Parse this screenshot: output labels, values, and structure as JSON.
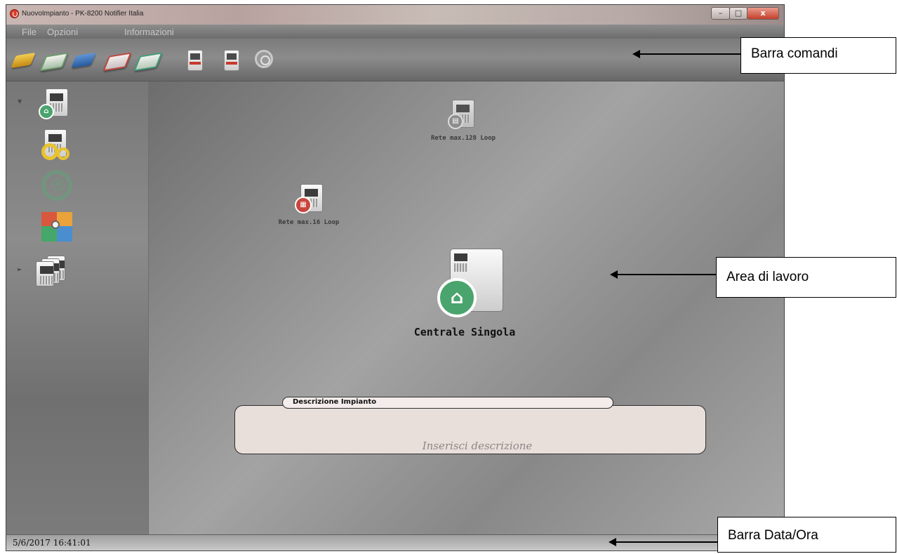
{
  "window": {
    "title": "NuovoImpianto - PK-8200 Notifier Italia",
    "controls": {
      "minimize": "–",
      "maximize": "□",
      "close": "x"
    }
  },
  "menu": {
    "items": [
      "File",
      "Opzioni",
      "Informazioni"
    ]
  },
  "toolbar": {
    "icons": [
      "new-project-icon",
      "edit-project-icon",
      "save-icon",
      "export-pdf-icon",
      "print-icon",
      "upload-panel-icon",
      "download-panel-icon",
      "help-icon"
    ]
  },
  "sidebar": {
    "icons": [
      "single-panel-icon",
      "configuration-gears-icon",
      "network-n-icon",
      "loop-network-icon",
      "panels-stack-icon"
    ]
  },
  "workarea": {
    "options": [
      {
        "label": "Rete max.128 Loop"
      },
      {
        "label": "Rete max.16 Loop"
      },
      {
        "label": "Centrale Singola"
      }
    ],
    "description": {
      "title": "Descrizione Impianto",
      "placeholder": "Inserisci descrizione"
    }
  },
  "statusbar": {
    "datetime": "5/6/2017  16:41:01"
  },
  "callouts": {
    "toolbar": "Barra comandi",
    "workarea": "Area di lavoro",
    "statusbar": "Barra Data/Ora"
  },
  "colors": {
    "close_button": "#c4412c",
    "workarea_bg": "#8f8f8f",
    "description_bg": "#e8dfdb",
    "house_badge": "#4aa46d"
  }
}
